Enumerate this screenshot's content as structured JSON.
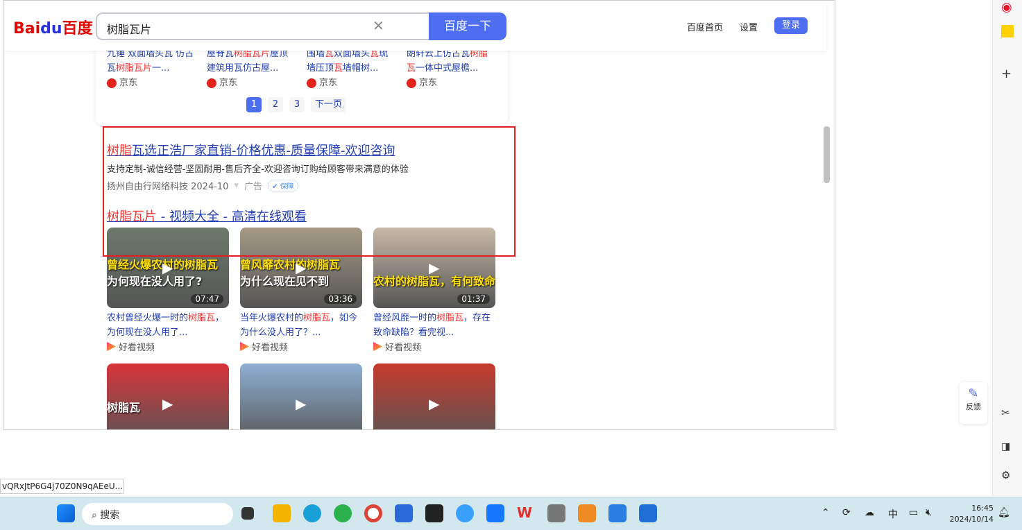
{
  "header": {
    "logo": "Bai百度",
    "logo_parts": [
      "Bai",
      "du",
      "百度"
    ],
    "search_value": "树脂瓦片",
    "search_button": "百度一下",
    "links": [
      "百度首页",
      "设置"
    ],
    "login": "登录"
  },
  "products": [
    {
      "line1": [
        [
          "九锤 双面墙头瓦 仿古",
          false
        ]
      ],
      "line2": [
        [
          "瓦",
          false
        ],
        [
          "树脂瓦片",
          true
        ],
        [
          "一...",
          false
        ]
      ],
      "source": "京东"
    },
    {
      "line1": [
        [
          "屋脊瓦",
          false
        ],
        [
          "树脂瓦片",
          true
        ],
        [
          "屋顶",
          false
        ]
      ],
      "line2": [
        [
          "建筑用瓦仿古屋...",
          false
        ]
      ],
      "source": "京东"
    },
    {
      "line1": [
        [
          "围墙",
          false
        ],
        [
          "瓦",
          true
        ],
        [
          "双面墙头",
          false
        ],
        [
          "瓦",
          true
        ],
        [
          "琉",
          false
        ]
      ],
      "line2": [
        [
          "墙压顶",
          false
        ],
        [
          "瓦",
          true
        ],
        [
          "墙帽树...",
          false
        ]
      ],
      "source": "京东"
    },
    {
      "line1": [
        [
          "朗轩云上仿古瓦",
          false
        ],
        [
          "树脂",
          true
        ]
      ],
      "line2": [
        [
          "瓦",
          true
        ],
        [
          "一体中式屋檐...",
          false
        ]
      ],
      "source": "京东"
    }
  ],
  "pager": {
    "pages": [
      "1",
      "2",
      "3"
    ],
    "next": "下一页",
    "current": "1"
  },
  "ad": {
    "title_highlight": "树脂",
    "title_rest": "瓦选正浩厂家直销-价格优惠-质量保障-欢迎咨询",
    "desc": "支持定制-诚信经营-坚固耐用-售后齐全-欢迎咨询订购给顾客带来满意的体验",
    "company": "扬州自由行网络科技 2024-10",
    "ad_label": "广告",
    "badge": "保障"
  },
  "video_section": {
    "title_highlight": "树脂瓦片",
    "title_rest": " - 视频大全 - 高清在线观看"
  },
  "videos": [
    {
      "caption": "曾经火爆农村的树脂瓦",
      "caption2": "为何现在没人用了?",
      "duration": "07:47",
      "pre": "农村曾经火爆一时的",
      "hl": "树脂瓦",
      "post": "，为何现在没人用了...",
      "source": "好看视频",
      "color": "#6c7a6a"
    },
    {
      "caption": "曾风靡农村的树脂瓦",
      "caption2": "为什么现在见不到",
      "duration": "03:36",
      "pre": "当年火爆农村的",
      "hl": "树脂瓦",
      "post": "，如今为什么没人用了？...",
      "source": "好看视频",
      "color": "#a59a86"
    },
    {
      "caption": "农村的树脂瓦，有何致命缺陷?",
      "caption2": "",
      "duration": "01:37",
      "pre": "曾经风靡一时的",
      "hl": "树脂瓦",
      "post": "，存在致命缺陷？看完视...",
      "source": "好看视频",
      "color": "#c8b9a8"
    },
    {
      "caption": "树脂瓦",
      "caption2": "",
      "duration": "",
      "pre": "",
      "hl": "",
      "post": "",
      "source": "",
      "color": "#d8343a"
    },
    {
      "caption": "",
      "caption2": "",
      "duration": "",
      "pre": "",
      "hl": "",
      "post": "",
      "source": "",
      "color": "#8fb0d4"
    },
    {
      "caption": "",
      "caption2": "",
      "duration": "",
      "pre": "",
      "hl": "",
      "post": "",
      "source": "",
      "color": "#c63a2c"
    }
  ],
  "feedback": "反馈",
  "status_url": "vQRxJtP6G4j70Z0N9qAEeU...",
  "taskbar": {
    "search": "搜索",
    "ime": "中",
    "time": "16:45",
    "date": "2024/10/14"
  }
}
